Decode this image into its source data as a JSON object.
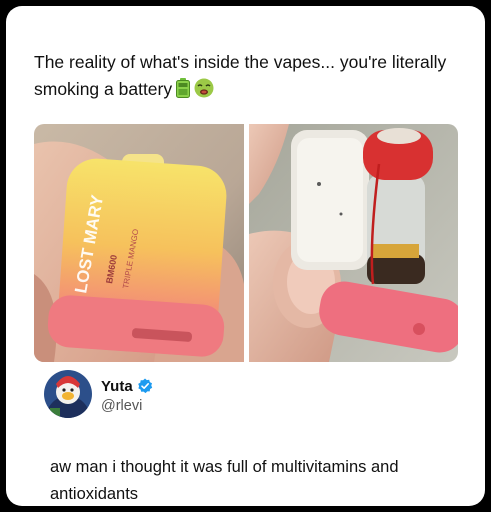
{
  "post": {
    "text": "The reality of what's inside the vapes... you're literally smoking a battery",
    "emojis": [
      "battery-emoji",
      "nauseated-face-emoji"
    ]
  },
  "photos": {
    "left": {
      "brand_text": "LOST MARY",
      "model_text": "BM600",
      "flavor_text": "TRIPLE MANGO"
    },
    "right": {
      "icon": "disassembled-vape"
    }
  },
  "reply": {
    "display_name": "Yuta",
    "handle": "@rlevi",
    "verified_color": "#1d9bf0",
    "text": "aw man i thought it was full of multivitamins and antioxidants"
  }
}
